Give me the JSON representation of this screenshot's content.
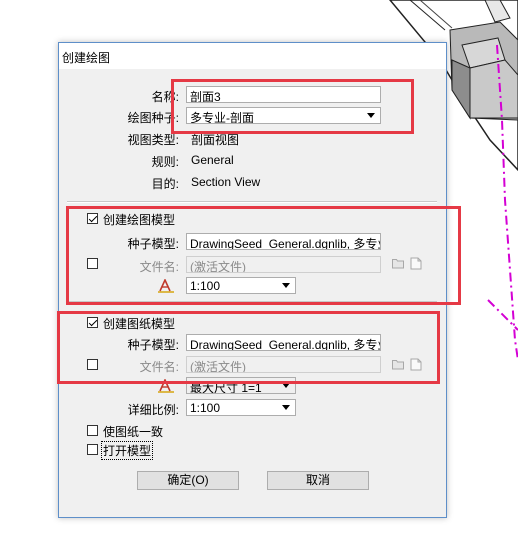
{
  "dialog": {
    "title": "创建绘图",
    "name_label": "名称:",
    "name_value": "剖面3",
    "seed_label": "绘图种子:",
    "seed_value": "多专业-剖面",
    "view_type_label": "视图类型:",
    "view_type_value": "剖面视图",
    "rule_label": "规则:",
    "rule_value": "General",
    "purpose_label": "目的:",
    "purpose_value": "Section View",
    "drawing_model": {
      "checkbox_label": "创建绘图模型",
      "checked": true,
      "seed_model_label": "种子模型:",
      "seed_model_value": "DrawingSeed_General.dgnlib, 多专业-剖",
      "file_label": "文件名:",
      "file_placeholder": "(激活文件)",
      "file_checked": false,
      "scale_value": "1:100"
    },
    "sheet_model": {
      "checkbox_label": "创建图纸模型",
      "checked": true,
      "seed_model_label": "种子模型:",
      "seed_model_value": "DrawingSeed_General.dgnlib, 多专业-剖",
      "file_label": "文件名:",
      "file_placeholder": "(激活文件)",
      "file_checked": false,
      "size_value": "最大尺寸 1=1",
      "detail_scale_label": "详细比例:",
      "detail_scale_value": "1:100"
    },
    "fit_sheet_label": "使图纸一致",
    "fit_sheet_checked": false,
    "open_model_label": "打开模型",
    "open_model_checked": false,
    "ok_label": "确定(O)",
    "cancel_label": "取消"
  },
  "colors": {
    "annotation_red": "#e53945",
    "dialog_bg": "#f0f0f0",
    "dialog_border": "#5e8fc9",
    "magenta_line": "#d400d4"
  },
  "icons": [
    "annotation-scale-icon",
    "folder-open-icon",
    "new-file-icon"
  ]
}
